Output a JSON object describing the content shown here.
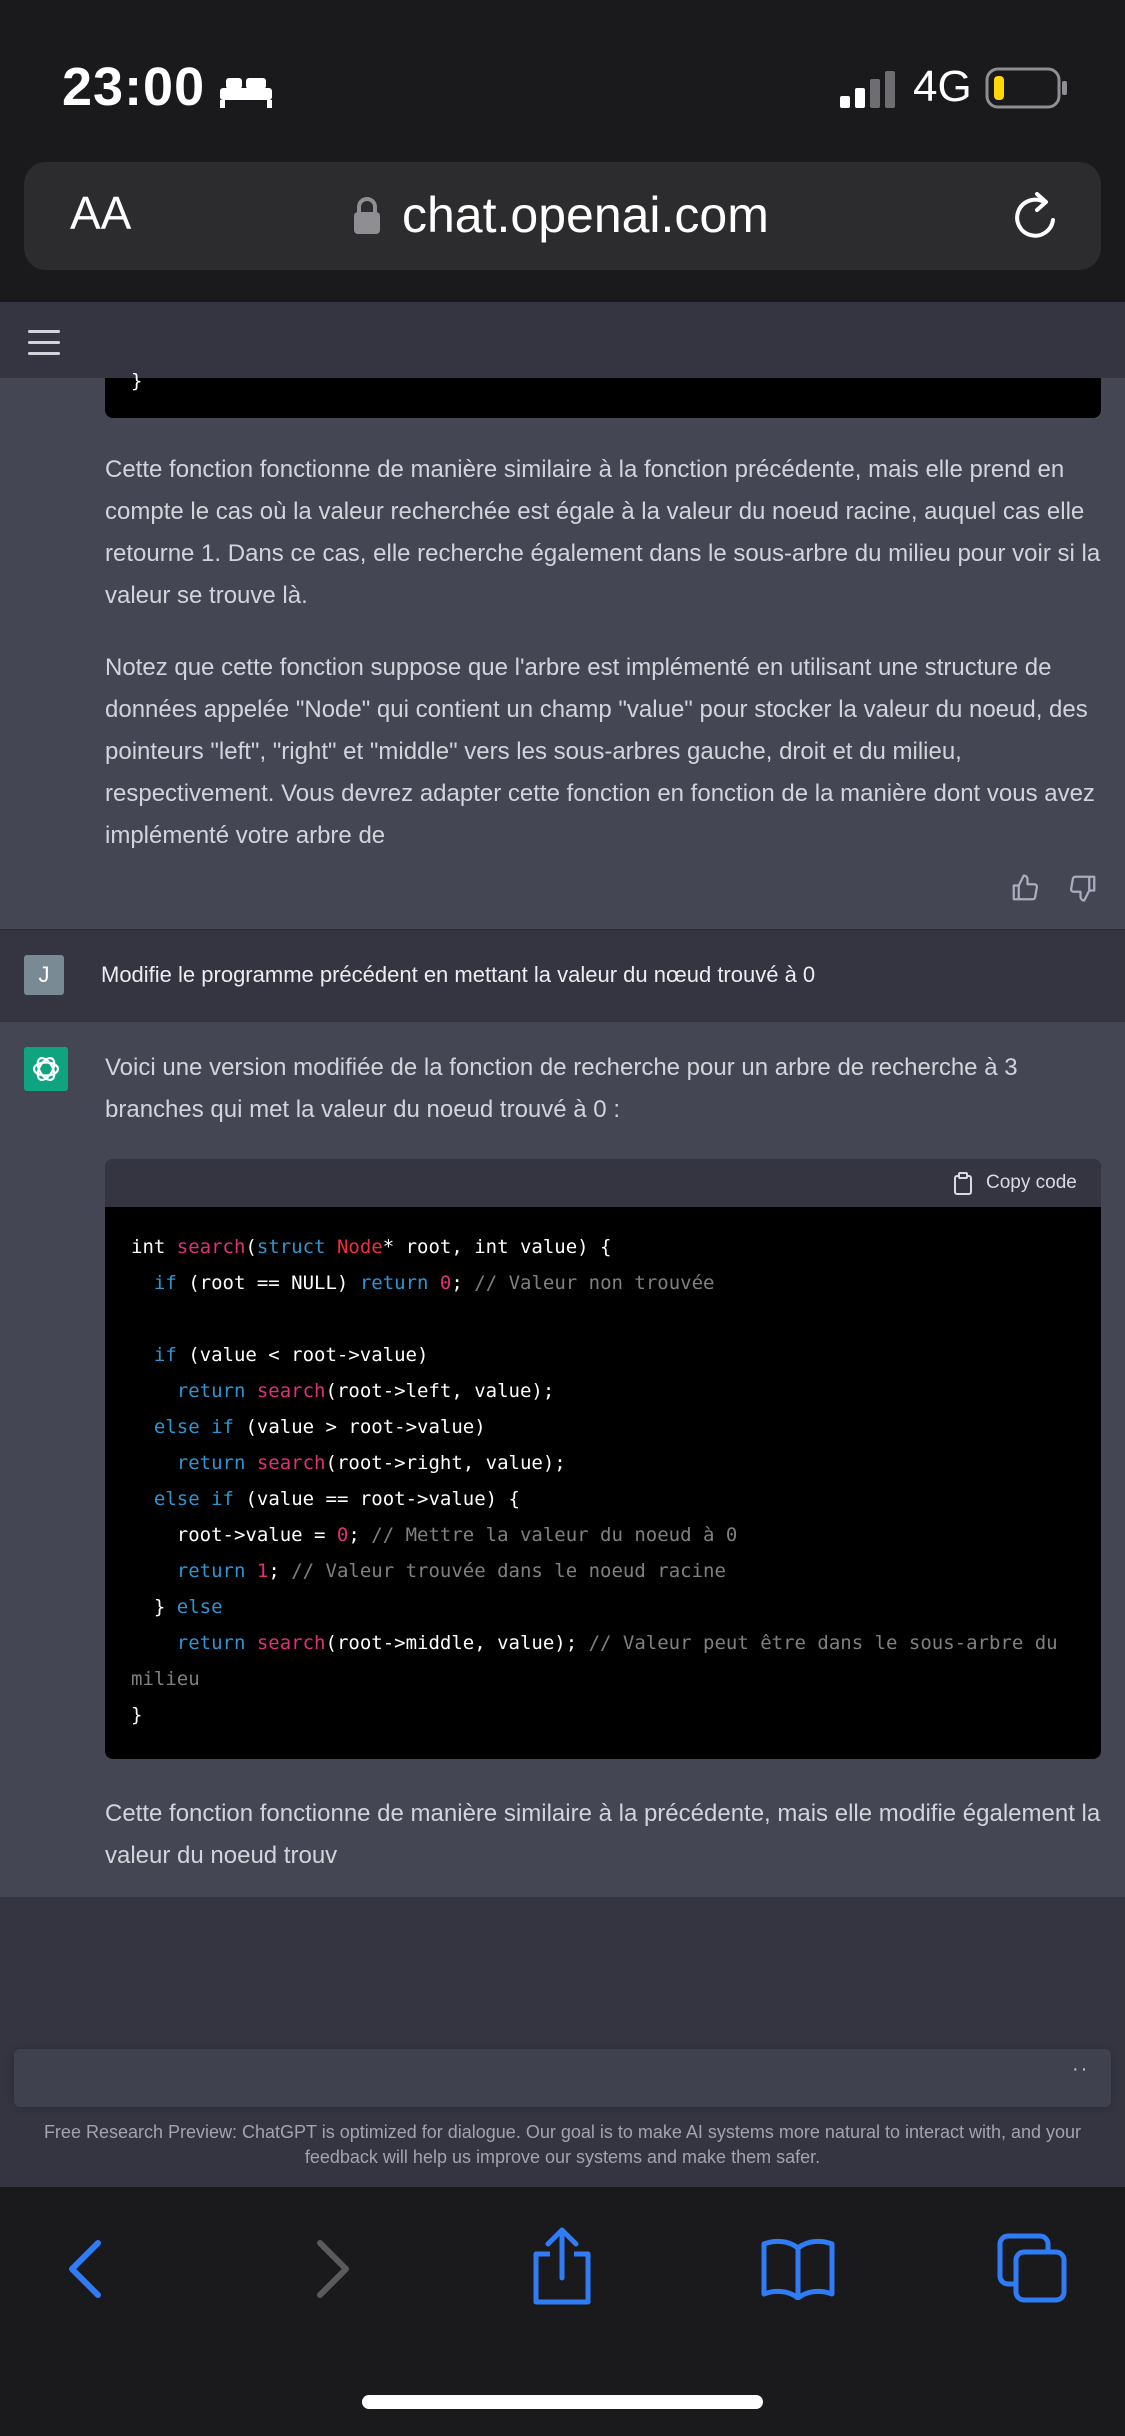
{
  "status_bar": {
    "time": "23:00",
    "network": "4G",
    "icons": [
      "bed-icon",
      "signal-icon",
      "battery-icon"
    ],
    "battery_level": 0.15
  },
  "url_bar": {
    "text_size_label": "AA",
    "domain": "chat.openai.com",
    "icons": [
      "lock-icon",
      "reload-icon"
    ]
  },
  "app_header": {
    "icons": [
      "hamburger-menu-icon"
    ]
  },
  "conversation": {
    "assistant_1": {
      "paragraphs": [
        "Cette fonction fonctionne de manière similaire à la fonction précédente, mais elle prend en compte le cas où la valeur recherchée est égale à la valeur du noeud racine, auquel cas elle retourne 1. Dans ce cas, elle recherche également dans le sous-arbre du milieu pour voir si la valeur se trouve là.",
        "Notez que cette fonction suppose que l'arbre est implémenté en utilisant une structure de données appelée \"Node\" qui contient un champ \"value\" pour stocker la valeur du noeud, des pointeurs \"left\", \"right\" et \"middle\" vers les sous-arbres gauche, droit et du milieu, respectivement. Vous devrez adapter cette fonction en fonction de la manière dont vous avez implémenté votre arbre de"
      ],
      "code_tail": "}"
    },
    "user": {
      "avatar_letter": "J",
      "message": "Modifie le programme précédent en mettant la valeur du nœud trouvé à 0"
    },
    "assistant_2": {
      "intro": "Voici une version modifiée de la fonction de recherche pour un arbre de recherche à 3 branches qui met la valeur du noeud trouvé à 0 :",
      "copy_label": "Copy code",
      "code_lines": [
        "int search(struct Node* root, int value) {",
        "  if (root == NULL) return 0; // Valeur non trouvée",
        "",
        "  if (value < root->value)",
        "    return search(root->left, value);",
        "  else if (value > root->value)",
        "    return search(root->right, value);",
        "  else if (value == root->value) {",
        "    root->value = 0; // Mettre la valeur du noeud à 0",
        "    return 1; // Valeur trouvée dans le noeud racine",
        "  } else",
        "    return search(root->middle, value); // Valeur peut être dans le sous-arbre du milieu",
        "}"
      ],
      "outro": "Cette fonction fonctionne de manière similaire à la précédente, mais elle modifie également la valeur du noeud trouv"
    }
  },
  "composer": {
    "dots": "··",
    "footer": "Free Research Preview: ChatGPT is optimized for dialogue. Our goal is to make AI systems more natural to interact with, and your feedback will help us improve our systems and make them safer."
  },
  "safari_toolbar": {
    "icons": [
      "back-icon",
      "forward-icon",
      "share-icon",
      "bookmarks-icon",
      "tabs-icon"
    ]
  },
  "colors": {
    "accent": "#10a37f",
    "ios_blue": "#2f7cf6",
    "assistant_bg": "#444654",
    "user_bg": "#343541"
  }
}
